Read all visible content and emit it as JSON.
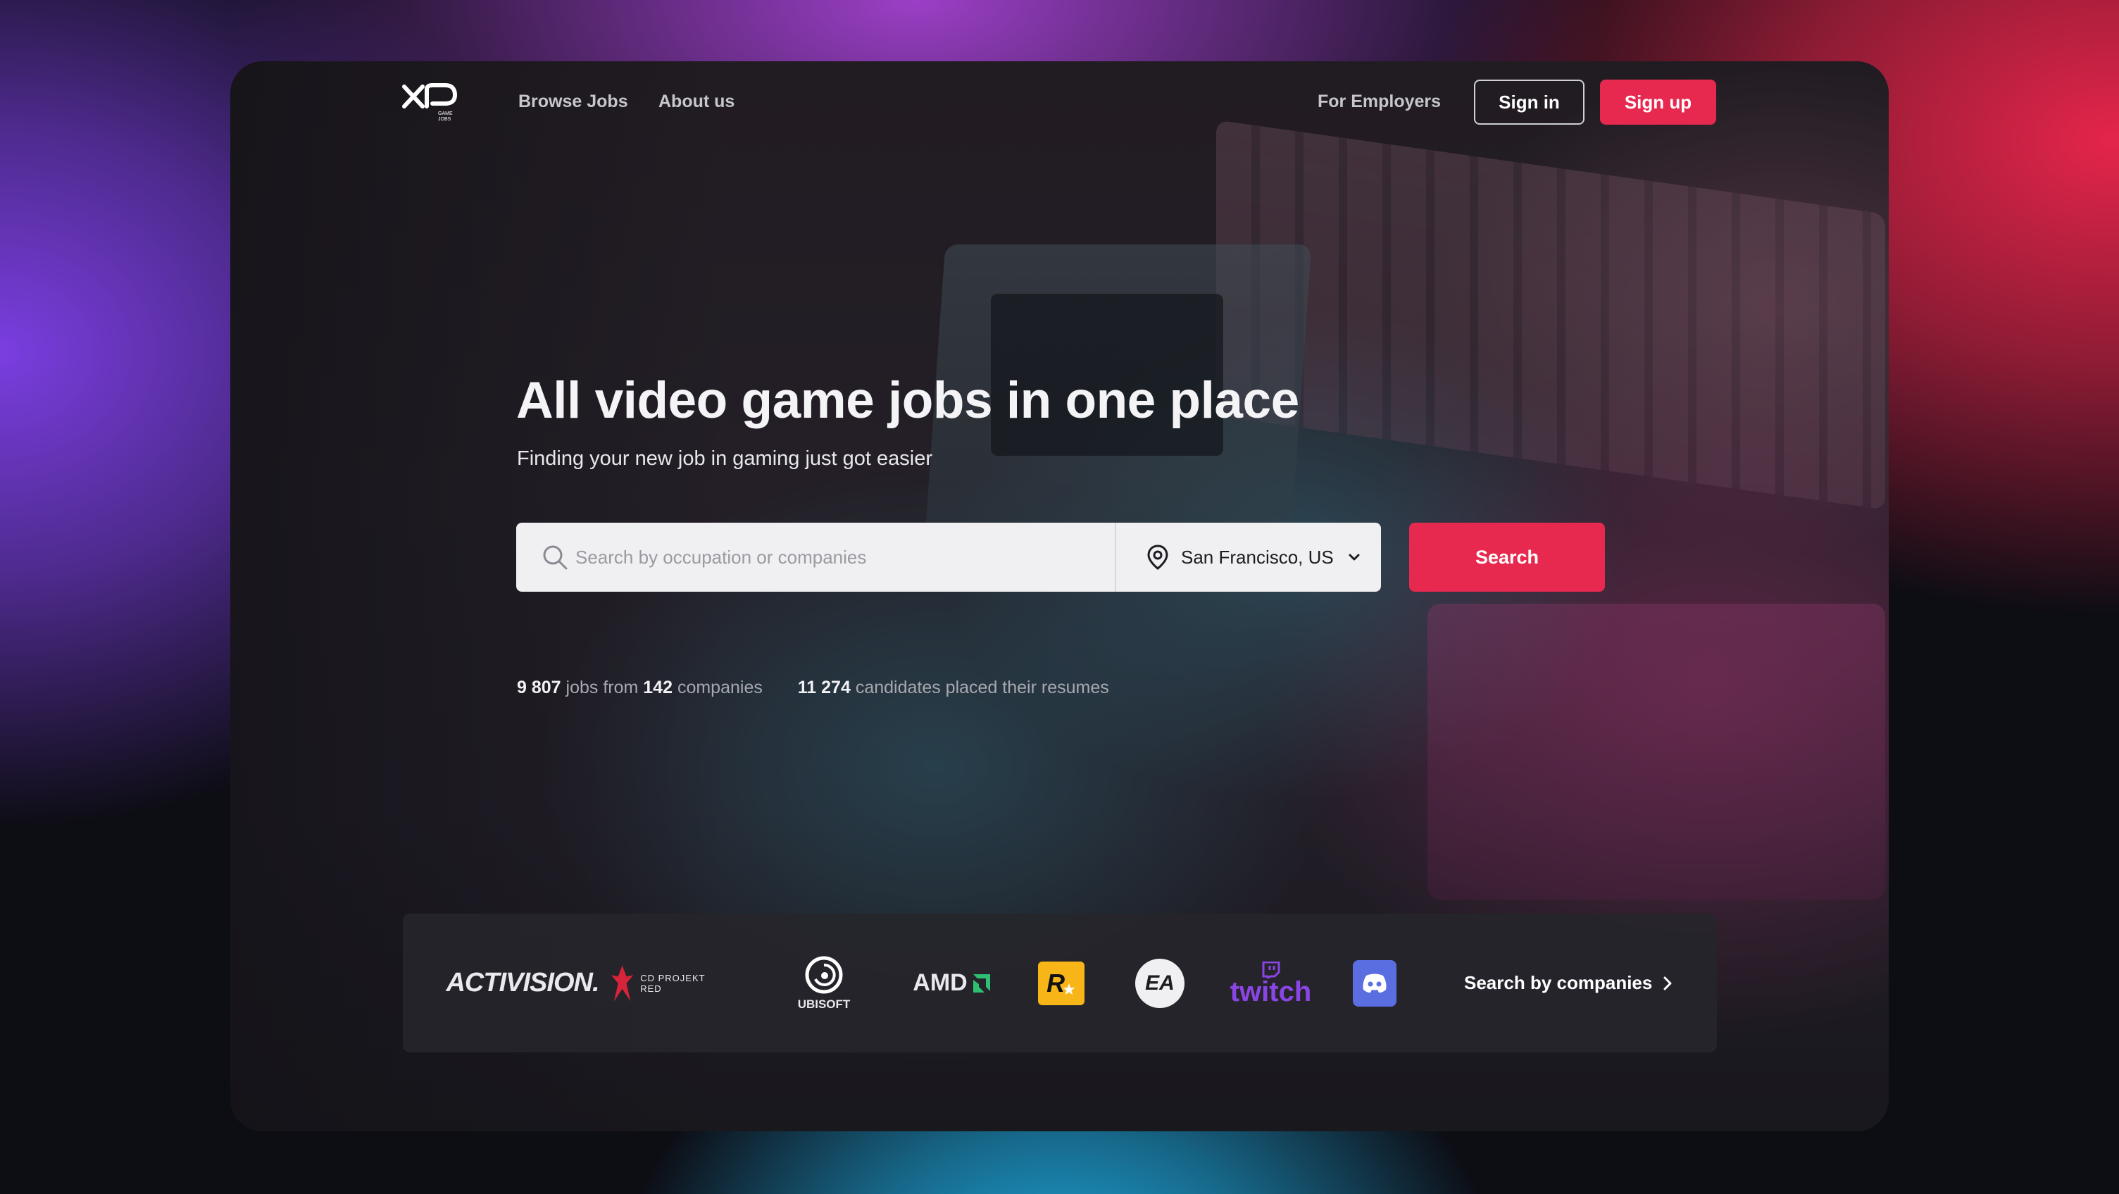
{
  "nav": {
    "logo_label": "XP",
    "logo_sub": "GAME JOBS",
    "browse_jobs": "Browse Jobs",
    "about_us": "About us",
    "for_employers": "For Employers",
    "sign_in": "Sign in",
    "sign_up": "Sign up"
  },
  "hero": {
    "title": "All video game jobs in one place",
    "subtitle": "Finding your new job in gaming just got easier"
  },
  "search": {
    "placeholder": "Search by occupation or companies",
    "value": "",
    "location": "San Francisco, US",
    "button": "Search"
  },
  "stats": {
    "jobs_count": "9 807",
    "jobs_from": "jobs from",
    "companies_count": "142",
    "companies_label": "companies",
    "candidates_count": "11 274",
    "candidates_label": "candidates placed their resumes"
  },
  "companies": {
    "logos": [
      {
        "name": "Activision",
        "text": "ACTIVISION."
      },
      {
        "name": "CD Projekt Red",
        "text": "CD PROJEKT RED"
      },
      {
        "name": "Ubisoft",
        "text": "UBISOFT"
      },
      {
        "name": "AMD",
        "text": "AMD"
      },
      {
        "name": "Rockstar",
        "text": "R"
      },
      {
        "name": "EA",
        "text": "EA"
      },
      {
        "name": "Twitch",
        "text": "twitch"
      },
      {
        "name": "Discord",
        "text": ""
      }
    ],
    "search_link": "Search by companies"
  },
  "colors": {
    "accent": "#e8294f",
    "card_bg": "#1d1c21",
    "twitch": "#8b45e6",
    "discord": "#5b6ee1",
    "rockstar": "#f7b518"
  },
  "icons": {
    "search": "search-icon",
    "location": "location-pin-icon",
    "dropdown": "chevron-down-icon",
    "link_arrow": "chevron-right-icon"
  }
}
